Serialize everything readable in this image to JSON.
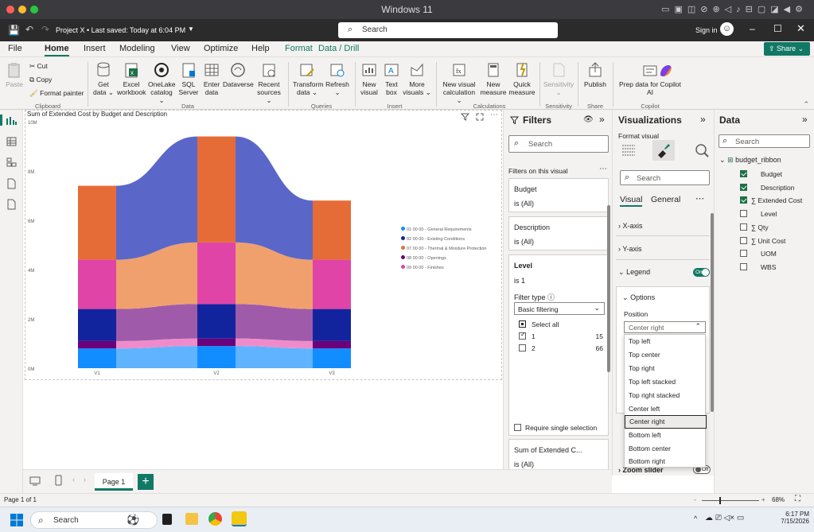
{
  "os_bar": {
    "title": "Windows 11"
  },
  "title_bar": {
    "project": "Project X • Last saved: Today at 6:04 PM",
    "search": "Search",
    "signin": "Sign in"
  },
  "menu": {
    "tabs": [
      "File",
      "Home",
      "Insert",
      "Modeling",
      "View",
      "Optimize",
      "Help",
      "Format",
      "Data / Drill"
    ],
    "share": "Share"
  },
  "ribbon": {
    "clipboard": {
      "paste": "Paste",
      "cut": "Cut",
      "copy": "Copy",
      "format_painter": "Format painter",
      "label": "Clipboard"
    },
    "data": {
      "get": "Get data",
      "excel": "Excel workbook",
      "onelake": "OneLake catalog",
      "sql": "SQL Server",
      "enter": "Enter data",
      "dataverse": "Dataverse",
      "recent": "Recent sources",
      "label": "Data"
    },
    "queries": {
      "transform": "Transform data",
      "refresh": "Refresh",
      "label": "Queries"
    },
    "insert": {
      "new_visual": "New visual",
      "text_box": "Text box",
      "more_visuals": "More visuals",
      "label": "Insert"
    },
    "calculations": {
      "new_visual_calc": "New visual calculation",
      "new_measure": "New measure",
      "quick_measure": "Quick measure",
      "label": "Calculations"
    },
    "sensitivity": {
      "btn": "Sensitivity",
      "label": "Sensitivity"
    },
    "share": {
      "publish": "Publish",
      "label": "Share"
    },
    "copilot": {
      "prep": "Prep data for Copilot AI",
      "label": "Copilot"
    }
  },
  "chart_data": {
    "type": "area",
    "title": "Sum of Extended Cost by Budget and Description",
    "categories": [
      "V1",
      "V2",
      "V3"
    ],
    "y_ticks": [
      "0M",
      "2M",
      "4M",
      "6M",
      "8M",
      "10M"
    ],
    "ylim": [
      0,
      10
    ],
    "series": [
      {
        "name": "01 00 00 - General Requirements",
        "color": "#118dff",
        "values": [
          0.8,
          0.9,
          0.8
        ]
      },
      {
        "name": "02 00 00 - Existing Conditions",
        "color": "#12239e",
        "values": [
          1.3,
          1.4,
          1.3
        ]
      },
      {
        "name": "07 00 00 - Thermal & Moisture Protection",
        "color": "#e66c37",
        "values": [
          3.0,
          4.3,
          2.4
        ]
      },
      {
        "name": "08 00 00 - Openings",
        "color": "#6b007b",
        "values": [
          0.3,
          0.3,
          0.3
        ]
      },
      {
        "name": "09 00 00 - Finishes",
        "color": "#e044a7",
        "values": [
          2.0,
          2.5,
          2.0
        ]
      }
    ],
    "legend_position": "center-right"
  },
  "filters": {
    "title": "Filters",
    "search": "Search",
    "on_visual": "Filters on this visual",
    "budget": {
      "name": "Budget",
      "value": "is (All)"
    },
    "description": {
      "name": "Description",
      "value": "is (All)"
    },
    "level": {
      "name": "Level",
      "value": "is 1",
      "filter_type_label": "Filter type",
      "filter_type": "Basic filtering",
      "select_all": "Select all",
      "items": [
        {
          "label": "1",
          "count": "15",
          "checked": true
        },
        {
          "label": "2",
          "count": "66",
          "checked": false
        }
      ]
    },
    "require_single": "Require single selection",
    "sum": {
      "name": "Sum of Extended C...",
      "value": "is (All)"
    }
  },
  "viz": {
    "title": "Visualizations",
    "format_visual": "Format visual",
    "search": "Search",
    "tabs": [
      "Visual",
      "General"
    ],
    "xaxis": "X-axis",
    "yaxis": "Y-axis",
    "legend": "Legend",
    "legend_toggle": "On",
    "options": "Options",
    "position_label": "Position",
    "position_value": "Center right",
    "position_options": [
      "Top left",
      "Top center",
      "Top right",
      "Top left stacked",
      "Top right stacked",
      "Center left",
      "Center right",
      "Bottom left",
      "Bottom center",
      "Bottom right"
    ],
    "zoom_slider": "Zoom slider",
    "zoom_toggle": "Off"
  },
  "data_pane": {
    "title": "Data",
    "search": "Search",
    "table": "budget_ribbon",
    "fields": [
      {
        "name": "Budget",
        "checked": true,
        "sigma": false
      },
      {
        "name": "Description",
        "checked": true,
        "sigma": false
      },
      {
        "name": "Extended Cost",
        "checked": true,
        "sigma": true
      },
      {
        "name": "Level",
        "checked": false,
        "sigma": false
      },
      {
        "name": "Qty",
        "checked": false,
        "sigma": true
      },
      {
        "name": "Unit Cost",
        "checked": false,
        "sigma": true
      },
      {
        "name": "UOM",
        "checked": false,
        "sigma": false
      },
      {
        "name": "WBS",
        "checked": false,
        "sigma": false
      }
    ]
  },
  "pages": {
    "current": "Page 1"
  },
  "status": {
    "page": "Page 1 of 1",
    "zoom": "68%"
  },
  "taskbar": {
    "search": "Search",
    "time": "6:17 PM",
    "date": "7/15/2026"
  }
}
